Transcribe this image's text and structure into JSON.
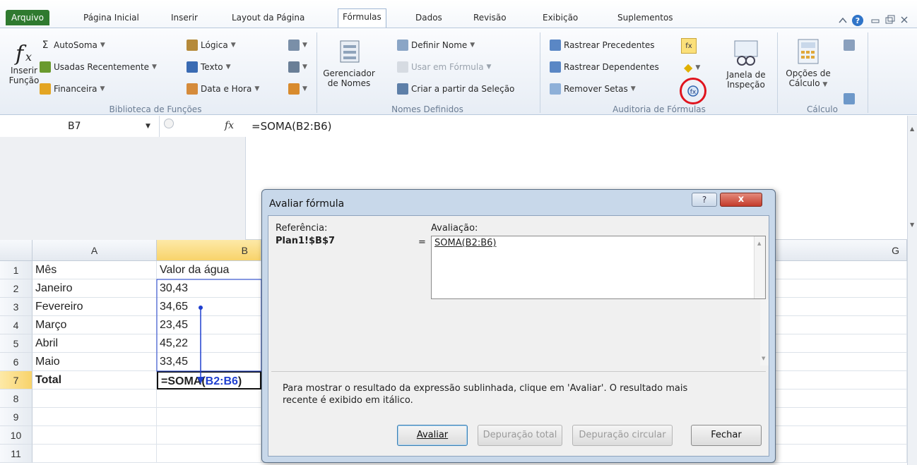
{
  "tabs": [
    "Arquivo",
    "Página Inicial",
    "Inserir",
    "Layout da Página",
    "Fórmulas",
    "Dados",
    "Revisão",
    "Exibição",
    "Suplementos"
  ],
  "ribbon": {
    "biblioteca": {
      "insert_function_l1": "Inserir",
      "insert_function_l2": "Função",
      "autosum": "AutoSoma",
      "recent": "Usadas Recentemente",
      "financial": "Financeira",
      "logical": "Lógica",
      "text": "Texto",
      "datetime": "Data e Hora",
      "group_label": "Biblioteca de Funções"
    },
    "nomes": {
      "manager_l1": "Gerenciador",
      "manager_l2": "de Nomes",
      "define": "Definir Nome",
      "use_in_formula": "Usar em Fórmula",
      "create_from_selection": "Criar a partir da Seleção",
      "group_label": "Nomes Definidos"
    },
    "auditoria": {
      "precedents": "Rastrear Precedentes",
      "dependents": "Rastrear Dependentes",
      "remove_arrows": "Remover Setas",
      "watch_l1": "Janela de",
      "watch_l2": "Inspeção",
      "group_label": "Auditoria de Fórmulas"
    },
    "calculo": {
      "options_l1": "Opções de",
      "options_l2": "Cálculo",
      "group_label": "Cálculo"
    }
  },
  "formula_bar": {
    "name_box": "B7",
    "fx_symbol": "fx",
    "formula": "=SOMA(B2:B6)"
  },
  "sheet": {
    "columns": [
      "A",
      "B",
      "G"
    ],
    "rows": [
      {
        "num": "1",
        "a": "Mês",
        "b": "Valor da água"
      },
      {
        "num": "2",
        "a": "Janeiro",
        "b": "30,43"
      },
      {
        "num": "3",
        "a": "Fevereiro",
        "b": "34,65"
      },
      {
        "num": "4",
        "a": "Março",
        "b": "23,45"
      },
      {
        "num": "5",
        "a": "Abril",
        "b": "45,22"
      },
      {
        "num": "6",
        "a": "Maio",
        "b": "33,45"
      },
      {
        "num": "7",
        "a": "Total",
        "b_prefix": "=SOMA(",
        "b_ref": "B2:B6",
        "b_suffix": ")"
      },
      {
        "num": "8"
      },
      {
        "num": "9"
      },
      {
        "num": "10"
      },
      {
        "num": "11"
      }
    ]
  },
  "dialog": {
    "title": "Avaliar fórmula",
    "reference_label": "Referência:",
    "reference_value": "Plan1!$B$7",
    "equals": "=",
    "evaluation_label": "Avaliação:",
    "evaluation_value": "SOMA(B2:B6)",
    "hint": "Para mostrar o resultado da expressão sublinhada, clique em 'Avaliar'. O resultado mais recente é exibido em itálico.",
    "buttons": {
      "evaluate": "Avaliar",
      "step_in": "Depuração total",
      "step_out": "Depuração circular",
      "close": "Fechar"
    },
    "help_symbol": "?",
    "close_symbol": "x"
  },
  "colors": {
    "file_tab": "#2f7a2f",
    "highlight_circle": "#e0141e",
    "trace_arrow": "#1f3fcf",
    "dialog_close": "#c43b2b"
  }
}
